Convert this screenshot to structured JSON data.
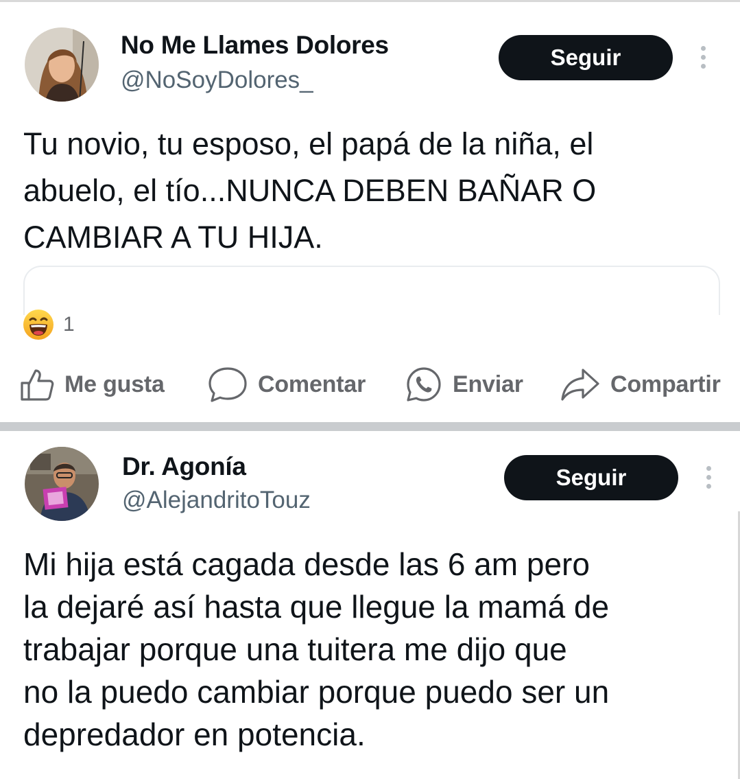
{
  "posts": [
    {
      "author_name": "No Me Llames Dolores",
      "handle": "@NoSoyDolores_",
      "follow_label": "Seguir",
      "text": "Tu novio, tu esposo, el papá de la niña, el\nabuelo, el tío...NUNCA DEBEN BAÑAR O\nCAMBIAR A TU HIJA.",
      "reaction_icon": "laughing-emoji",
      "reaction_count": "1",
      "actions": [
        {
          "label": "Me gusta",
          "icon": "thumbs-up-icon"
        },
        {
          "label": "Comentar",
          "icon": "comment-icon"
        },
        {
          "label": "Enviar",
          "icon": "whatsapp-icon"
        },
        {
          "label": "Compartir",
          "icon": "share-icon"
        }
      ]
    },
    {
      "author_name": "Dr. Agonía",
      "handle": "@AlejandritoTouz",
      "follow_label": "Seguir",
      "text": "Mi hija está cagada desde las 6 am pero\nla dejaré así hasta que llegue la mamá de\ntrabajar porque una tuitera me dijo que\nno la puedo cambiar porque puedo ser un\ndepredador en potencia."
    }
  ],
  "colors": {
    "button_bg": "#0f1419",
    "button_text": "#ffffff",
    "handle": "#536471",
    "action_text": "#65676b",
    "separator": "#c9cccf"
  }
}
